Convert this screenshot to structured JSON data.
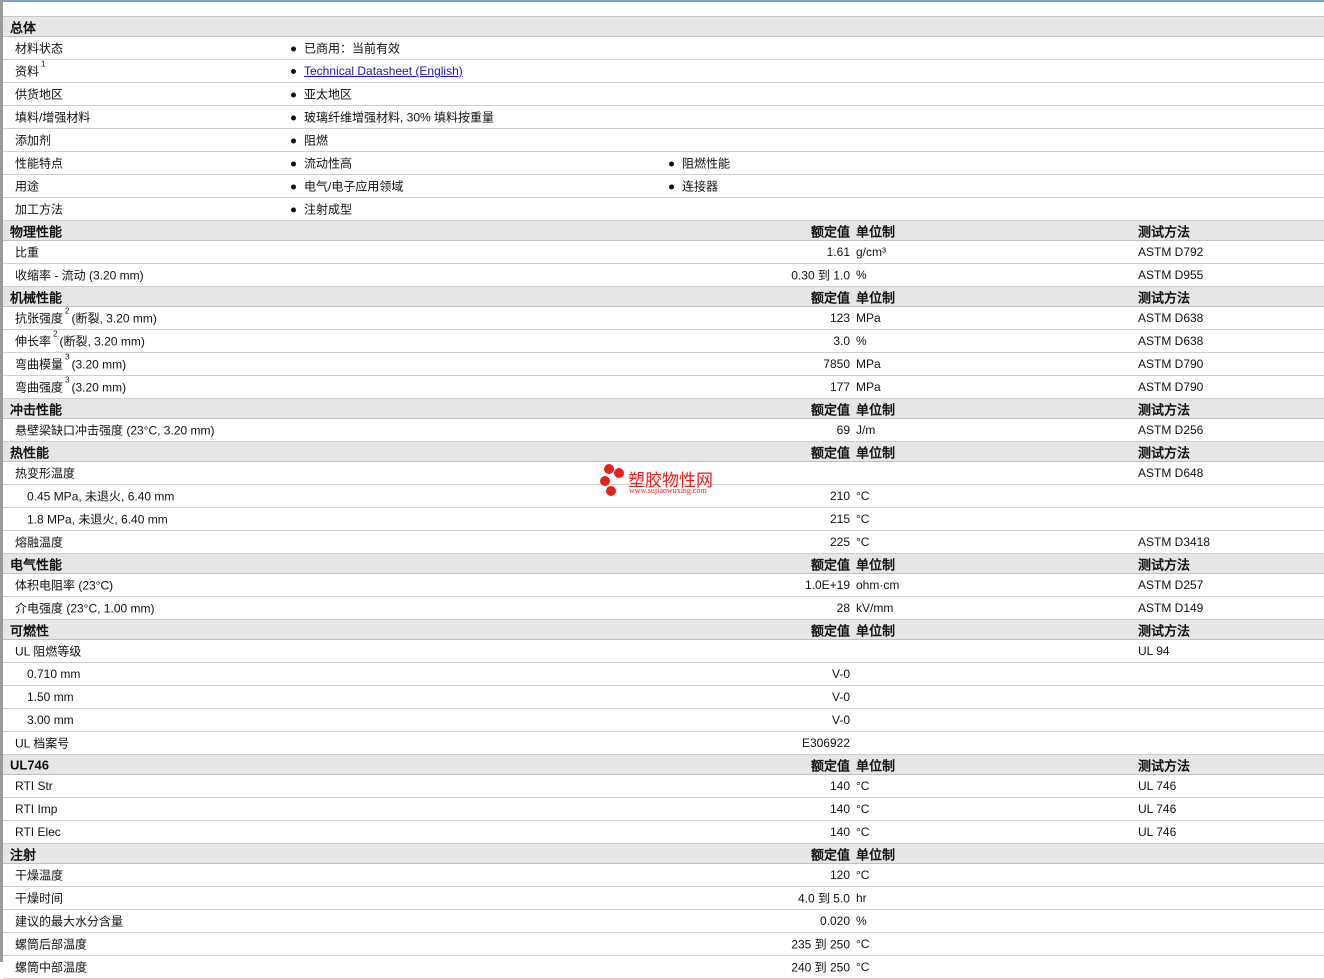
{
  "headers": {
    "value": "额定值",
    "unit": "单位制",
    "test": "测试方法"
  },
  "sections": [
    {
      "title": "总体",
      "kind": "general",
      "rows": [
        {
          "label": "材料状态",
          "b1": "已商用：当前有效"
        },
        {
          "label": "资料",
          "sup": "1",
          "b1": "Technical Datasheet (English)",
          "link": true
        },
        {
          "label": "供货地区",
          "b1": "亚太地区"
        },
        {
          "label": "填料/增强材料",
          "b1": "玻璃纤维增强材料, 30% 填料按重量"
        },
        {
          "label": "添加剂",
          "b1": "阻燃"
        },
        {
          "label": "性能特点",
          "b1": "流动性高",
          "b2": "阻燃性能"
        },
        {
          "label": "用途",
          "b1": "电气/电子应用领域",
          "b2": "连接器"
        },
        {
          "label": "加工方法",
          "b1": "注射成型"
        }
      ]
    },
    {
      "title": "物理性能",
      "rows": [
        {
          "label": "比重",
          "value": "1.61",
          "unit": "g/cm³",
          "test": "ASTM D792"
        },
        {
          "label": "收缩率 - 流动 (3.20 mm)",
          "value": "0.30 到 1.0",
          "unit": "%",
          "test": "ASTM D955"
        }
      ]
    },
    {
      "title": "机械性能",
      "rows": [
        {
          "label": "抗张强度",
          "sup": "2",
          "suffix": "(断裂, 3.20 mm)",
          "value": "123",
          "unit": "MPa",
          "test": "ASTM D638"
        },
        {
          "label": "伸长率",
          "sup": "2",
          "suffix": "(断裂, 3.20 mm)",
          "value": "3.0",
          "unit": "%",
          "test": "ASTM D638"
        },
        {
          "label": "弯曲模量",
          "sup": "3",
          "suffix": "(3.20 mm)",
          "value": "7850",
          "unit": "MPa",
          "test": "ASTM D790"
        },
        {
          "label": "弯曲强度",
          "sup": "3",
          "suffix": "(3.20 mm)",
          "value": "177",
          "unit": "MPa",
          "test": "ASTM D790"
        }
      ]
    },
    {
      "title": "冲击性能",
      "rows": [
        {
          "label": "悬壁梁缺口冲击强度 (23°C, 3.20 mm)",
          "value": "69",
          "unit": "J/m",
          "test": "ASTM D256"
        }
      ]
    },
    {
      "title": "热性能",
      "rows": [
        {
          "label": "热变形温度",
          "test": "ASTM D648"
        },
        {
          "label": "0.45 MPa, 未退火, 6.40 mm",
          "sub": true,
          "value": "210",
          "unit": "°C"
        },
        {
          "label": "1.8 MPa, 未退火, 6.40 mm",
          "sub": true,
          "value": "215",
          "unit": "°C"
        },
        {
          "label": "熔融温度",
          "value": "225",
          "unit": "°C",
          "test": "ASTM D3418"
        }
      ]
    },
    {
      "title": "电气性能",
      "rows": [
        {
          "label": "体积电阻率 (23°C)",
          "value": "1.0E+19",
          "unit": "ohm·cm",
          "test": "ASTM D257"
        },
        {
          "label": "介电强度 (23°C, 1.00 mm)",
          "value": "28",
          "unit": "kV/mm",
          "test": "ASTM D149"
        }
      ]
    },
    {
      "title": "可燃性",
      "rows": [
        {
          "label": "UL 阻燃等级",
          "test": "UL 94"
        },
        {
          "label": "0.710 mm",
          "sub": true,
          "value": "V-0"
        },
        {
          "label": "1.50 mm",
          "sub": true,
          "value": "V-0"
        },
        {
          "label": "3.00 mm",
          "sub": true,
          "value": "V-0"
        },
        {
          "label": "UL 档案号",
          "value": "E306922"
        }
      ]
    },
    {
      "title": "UL746",
      "rows": [
        {
          "label": "RTI Str",
          "value": "140",
          "unit": "°C",
          "test": "UL 746"
        },
        {
          "label": "RTI Imp",
          "value": "140",
          "unit": "°C",
          "test": "UL 746"
        },
        {
          "label": "RTI Elec",
          "value": "140",
          "unit": "°C",
          "test": "UL 746"
        }
      ]
    },
    {
      "title": "注射",
      "notest": true,
      "rows": [
        {
          "label": "干燥温度",
          "value": "120",
          "unit": "°C"
        },
        {
          "label": "干燥时间",
          "value": "4.0 到 5.0",
          "unit": "hr"
        },
        {
          "label": "建议的最大水分含量",
          "value": "0.020",
          "unit": "%"
        },
        {
          "label": "螺筒后部温度",
          "value": "235 到 250",
          "unit": "°C"
        },
        {
          "label": "螺筒中部温度",
          "value": "240 到 250",
          "unit": "°C"
        }
      ]
    }
  ],
  "watermark": {
    "name": "塑胶物性网",
    "url": "www.sujiaowuxing.com"
  },
  "colors": {
    "header_bg": "#e6e6e6",
    "link": "#1a1aa8",
    "watermark": "#e8211c"
  }
}
